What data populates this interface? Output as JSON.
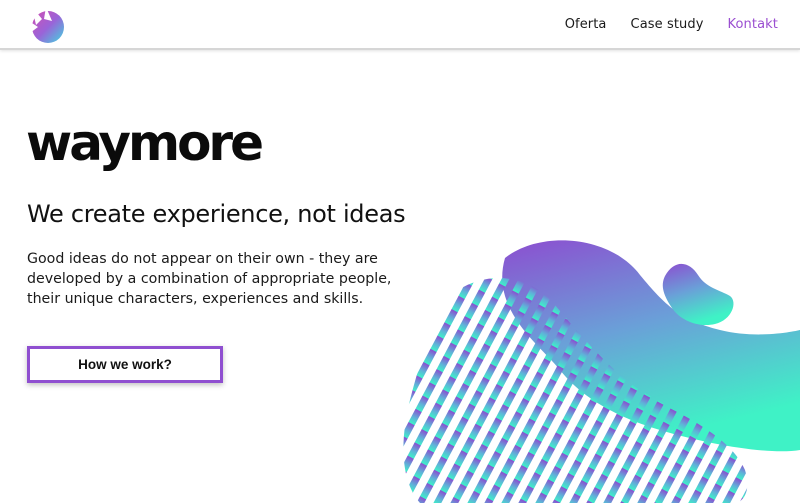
{
  "header": {
    "logo_icon": "waymore-logo-icon",
    "nav": [
      {
        "label": "Oferta"
      },
      {
        "label": "Case study"
      },
      {
        "label": "Kontakt",
        "active": true
      }
    ]
  },
  "hero": {
    "brand": "waymore",
    "tagline": "We create experience, not ideas",
    "description": "Good ideas do not appear on their own - they are developed by a combination of appropriate people, their unique characters, experiences and skills.",
    "cta_label": "How we work?"
  },
  "colors": {
    "accent": "#9b4fd1",
    "gradient_top": "#8e4fd0",
    "gradient_bottom": "#3df2c8",
    "text": "#111111"
  }
}
